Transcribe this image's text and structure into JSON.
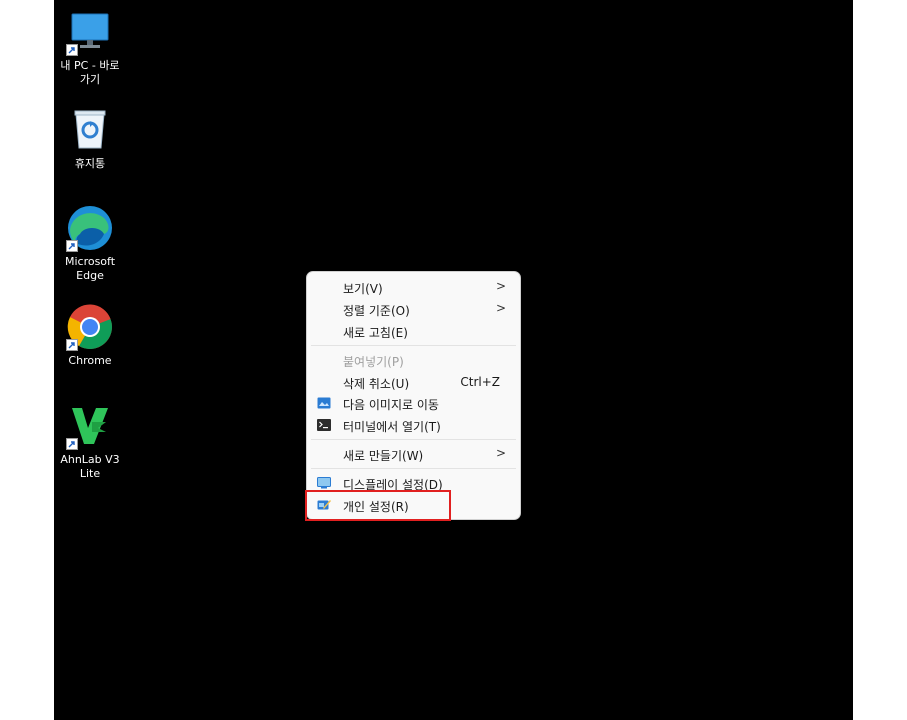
{
  "desktop_icons": [
    {
      "label": "내 PC - 바로\n가기",
      "icon": "monitor-icon"
    },
    {
      "label": "휴지통",
      "icon": "recycle-bin-icon"
    },
    {
      "label": "Microsoft\nEdge",
      "icon": "edge-icon"
    },
    {
      "label": "Chrome",
      "icon": "chrome-icon"
    },
    {
      "label": "AhnLab V3\nLite",
      "icon": "v3-icon"
    }
  ],
  "context_menu": {
    "items": [
      {
        "label": "보기(V)",
        "submenu_arrow": ">"
      },
      {
        "label": "정렬 기준(O)",
        "submenu_arrow": ">"
      },
      {
        "label": "새로 고침(E)"
      },
      {
        "label": "붙여넣기(P)",
        "disabled": true
      },
      {
        "label": "삭제 취소(U)",
        "shortcut": "Ctrl+Z"
      },
      {
        "label": "다음 이미지로 이동",
        "icon": "next-wallpaper-icon"
      },
      {
        "label": "터미널에서 열기(T)",
        "icon": "terminal-icon"
      },
      {
        "label": "새로 만들기(W)",
        "submenu_arrow": ">"
      },
      {
        "label": "디스플레이 설정(D)",
        "icon": "display-icon"
      },
      {
        "label": "개인 설정(R)",
        "icon": "personalize-icon"
      }
    ]
  },
  "colors": {
    "desktop_bg": "#000000",
    "menu_bg": "#f9f9f9",
    "highlight_border": "#e12020"
  }
}
